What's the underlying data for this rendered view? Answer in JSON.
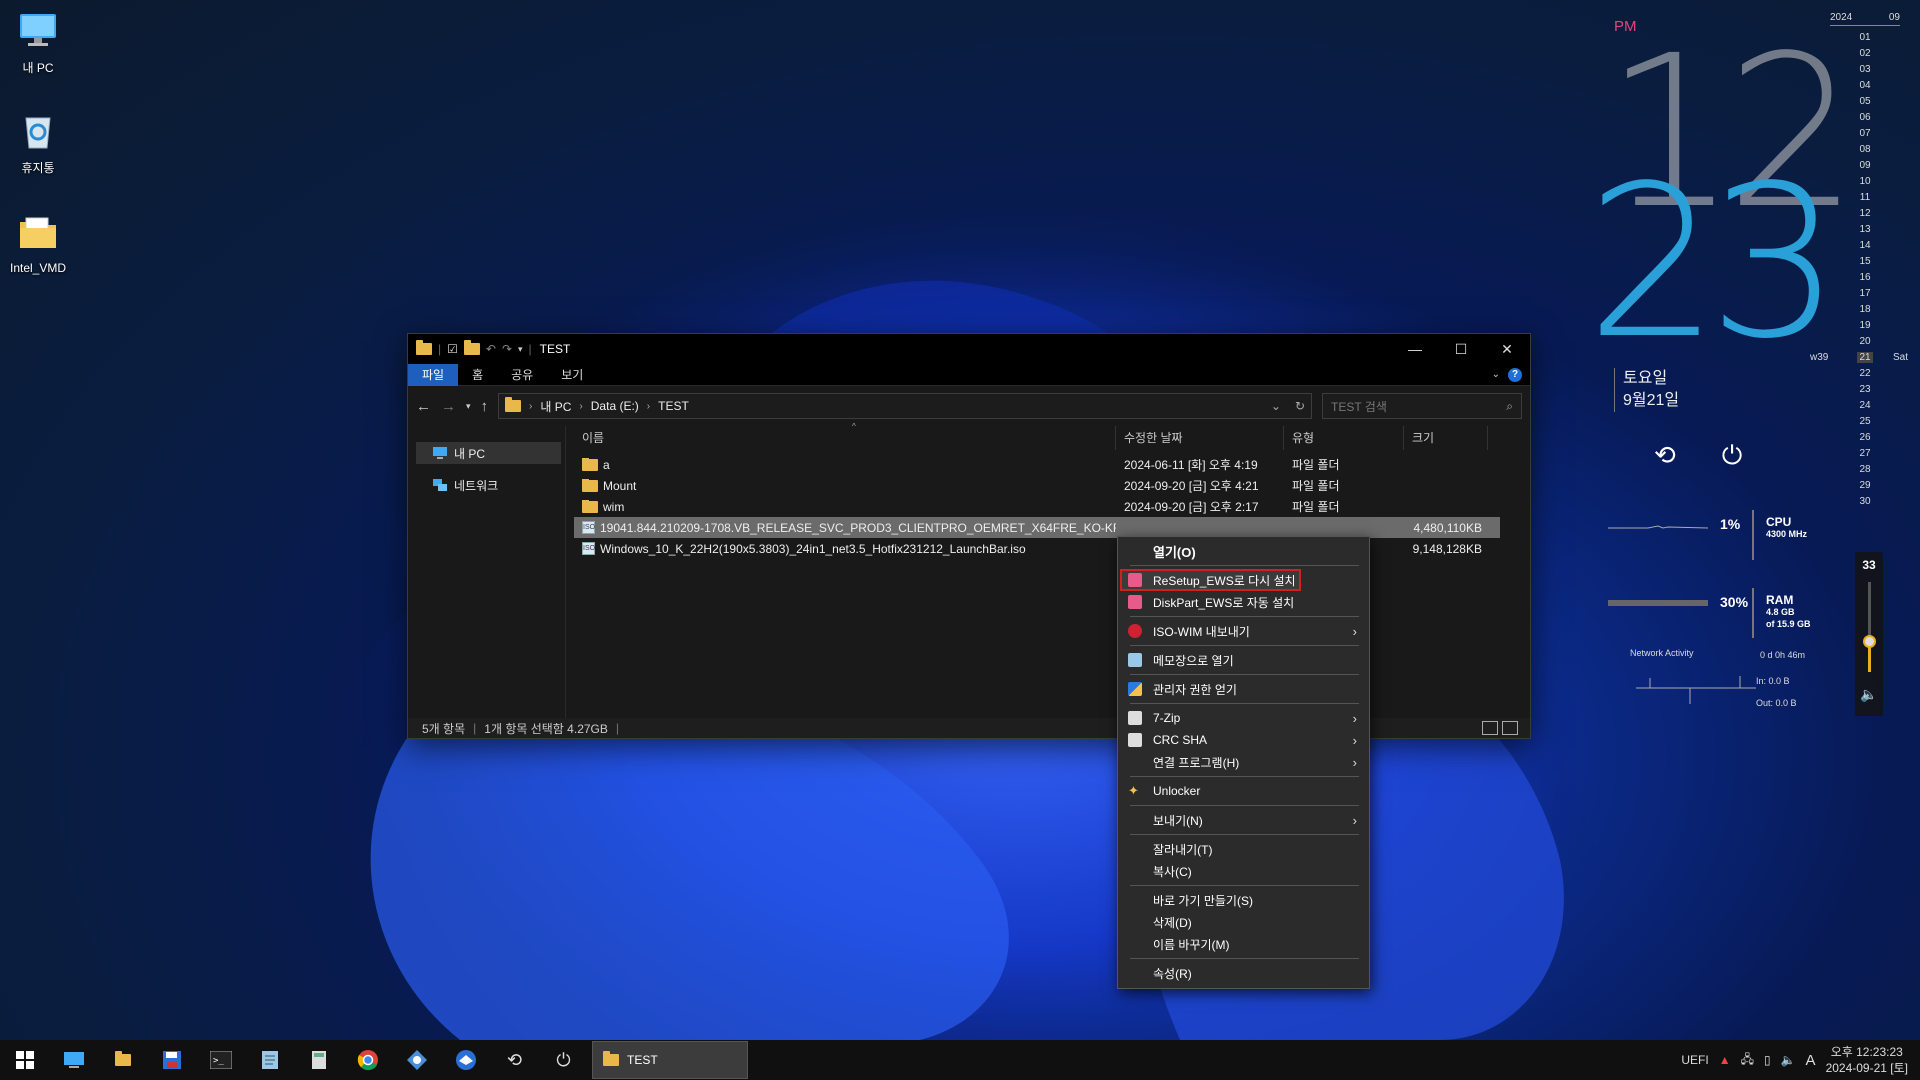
{
  "desktop": {
    "icons": [
      {
        "label": "내 PC"
      },
      {
        "label": "휴지통"
      },
      {
        "label": "Intel_VMD"
      }
    ]
  },
  "explorer": {
    "title": "TEST",
    "ribbon_tabs": [
      "파일",
      "홈",
      "공유",
      "보기"
    ],
    "breadcrumb": [
      "내 PC",
      "Data (E:)",
      "TEST"
    ],
    "search_placeholder": "TEST 검색",
    "nav": [
      "내 PC",
      "네트워크"
    ],
    "columns": [
      "이름",
      "수정한 날짜",
      "유형",
      "크기"
    ],
    "files": [
      {
        "name": "a",
        "date": "2024-06-11 [화] 오후 4:19",
        "type": "파일 폴더",
        "size": "",
        "kind": "folder"
      },
      {
        "name": "Mount",
        "date": "2024-09-20 [금] 오후 4:21",
        "type": "파일 폴더",
        "size": "",
        "kind": "folder"
      },
      {
        "name": "wim",
        "date": "2024-09-20 [금] 오후 2:17",
        "type": "파일 폴더",
        "size": "",
        "kind": "folder"
      },
      {
        "name": "19041.844.210209-1708.VB_RELEASE_SVC_PROD3_CLIENTPRO_OEMRET_X64FRE_KO-KR.ISO",
        "date": "",
        "type": "",
        "size": "4,480,110KB",
        "kind": "iso"
      },
      {
        "name": "Windows_10_K_22H2(190x5.3803)_24in1_net3.5_Hotfix231212_LaunchBar.iso",
        "date": "",
        "type": "",
        "size": "9,148,128KB",
        "kind": "iso"
      }
    ],
    "status": {
      "count": "5개 항목",
      "selected": "1개 항목 선택함 4.27GB"
    }
  },
  "context_menu": {
    "items": [
      {
        "label": "열기(O)"
      },
      {
        "label": "ReSetup_EWS로 다시 설치"
      },
      {
        "label": "DiskPart_EWS로 자동 설치"
      },
      {
        "label": "ISO-WIM 내보내기"
      },
      {
        "label": "메모장으로 열기"
      },
      {
        "label": "관리자 권한 얻기"
      },
      {
        "label": "7-Zip"
      },
      {
        "label": "CRC SHA"
      },
      {
        "label": "연결 프로그램(H)"
      },
      {
        "label": "Unlocker"
      },
      {
        "label": "보내기(N)"
      },
      {
        "label": "잘라내기(T)"
      },
      {
        "label": "복사(C)"
      },
      {
        "label": "바로 가기 만들기(S)"
      },
      {
        "label": "삭제(D)"
      },
      {
        "label": "이름 바꾸기(M)"
      },
      {
        "label": "속성(R)"
      }
    ]
  },
  "clock_widget": {
    "ampm": "PM",
    "hour": "12",
    "minute": "23",
    "weekday": "토요일",
    "date": "9월21일"
  },
  "monitors": {
    "cpu": {
      "percent": "1%",
      "label": "CPU",
      "sub": "4300 MHz"
    },
    "ram": {
      "percent": "30%",
      "label": "RAM",
      "sub1": "4.8 GB",
      "sub2": "of 15.9 GB"
    },
    "network": {
      "title": "Network Activity",
      "uptime": "0 d 0h 46m",
      "in": "In: 0.0 B",
      "out": "Out: 0.0 B"
    }
  },
  "calendar": {
    "year": "2024",
    "month": "09",
    "week": "w39",
    "today": "21",
    "today_day": "Sat",
    "days_before": [
      "01",
      "02",
      "03",
      "04",
      "05",
      "06",
      "07",
      "08",
      "09",
      "10",
      "11",
      "12",
      "13",
      "14",
      "15",
      "16",
      "17",
      "18",
      "19",
      "20"
    ],
    "days_after": [
      "22",
      "23",
      "24",
      "25",
      "26",
      "27",
      "28",
      "29",
      "30"
    ]
  },
  "volume": {
    "level": "33",
    "fraction": 0.33
  },
  "taskbar": {
    "task_label": "TEST",
    "tray_uefi": "UEFI",
    "tray_ime": "A",
    "time": "오후 12:23:23",
    "date": "2024-09-21 [토]"
  }
}
